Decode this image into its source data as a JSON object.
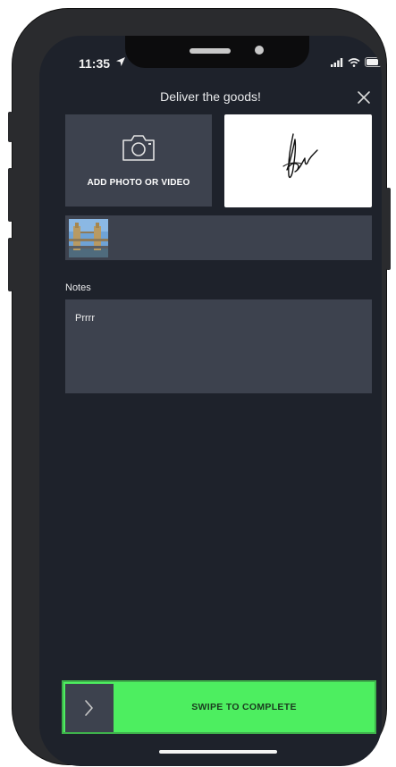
{
  "status_bar": {
    "time": "11:35"
  },
  "header": {
    "title": "Deliver the goods!"
  },
  "media": {
    "add_label": "ADD PHOTO OR VIDEO"
  },
  "notes": {
    "label": "Notes",
    "value": "Prrrr"
  },
  "swipe": {
    "label": "SWIPE TO COMPLETE"
  },
  "colors": {
    "background": "#1e222b",
    "panel": "#3d424e",
    "accent_green": "#4dee60"
  },
  "icons": {
    "location": "location-arrow-icon",
    "close": "close-icon",
    "camera": "camera-icon",
    "chevron": "chevron-right-icon"
  }
}
